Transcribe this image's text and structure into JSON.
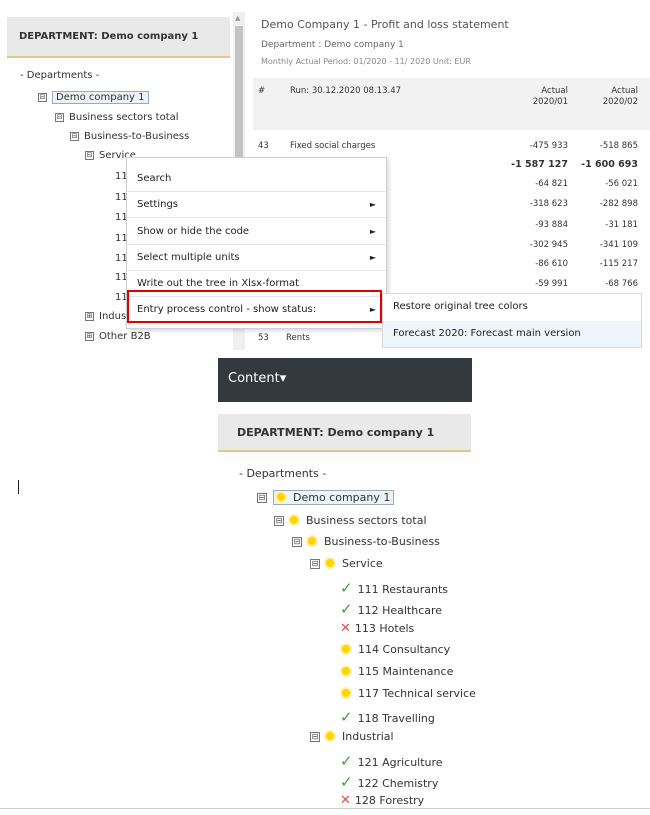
{
  "top": {
    "dept_header": "DEPARTMENT: Demo company 1",
    "tree": {
      "root": "- Departments -",
      "company": "Demo company 1",
      "sectors": "Business sectors total",
      "b2b": "Business-to-Business",
      "service": "Service",
      "partial_codes": [
        "11",
        "11",
        "11",
        "11",
        "11",
        "11",
        "11"
      ],
      "industrial": "Indust",
      "other": "Other B2B",
      "toggle_minus": "⊟",
      "toggle_plus": "⊞"
    },
    "report": {
      "title": "Demo Company 1 - Profit and loss statement",
      "department": "Department : Demo company 1",
      "period": "Monthly Actual Period: 01/2020 - 11/ 2020 Unit: EUR",
      "hash": "#",
      "run": "Run: 30.12.2020 08.13.47",
      "col1_top": "Actual",
      "col1_bottom": "2020/01",
      "col2_top": "Actual",
      "col2_bottom": "2020/02",
      "rows": [
        {
          "num": "43",
          "label": "Fixed social charges",
          "v1": "-475 933",
          "v2": "-518 865"
        },
        {
          "num": "",
          "label": "",
          "v1": "-1 587 127",
          "v2": "-1 600 693"
        },
        {
          "num": "",
          "label": "",
          "v1": "-64 821",
          "v2": "-56 021"
        },
        {
          "num": "",
          "label": "",
          "v1": "-318 623",
          "v2": "-282 898"
        },
        {
          "num": "",
          "label": "",
          "v1": "-93 884",
          "v2": "-31 181"
        },
        {
          "num": "",
          "label": "",
          "v1": "-302 945",
          "v2": "-341 109"
        },
        {
          "num": "",
          "label": "",
          "v1": "-86 610",
          "v2": "-115 217"
        },
        {
          "num": "",
          "label": "",
          "v1": "-59 991",
          "v2": "-68 766"
        },
        {
          "num": "53",
          "label": "Rents",
          "v1": "",
          "v2": ""
        }
      ]
    },
    "context_menu": {
      "items": [
        {
          "label": "Search",
          "has_sub": false
        },
        {
          "label": "Settings",
          "has_sub": true
        },
        {
          "label": "Show or hide the code",
          "has_sub": true
        },
        {
          "label": "Select multiple units",
          "has_sub": true
        },
        {
          "label": "Write out the tree in Xlsx-format",
          "has_sub": false
        },
        {
          "label": "Entry process control - show status:",
          "has_sub": true
        }
      ],
      "caret": "►"
    },
    "submenu": {
      "items": [
        "Restore original tree colors",
        "Forecast 2020: Forecast main version"
      ]
    }
  },
  "bottom": {
    "content_label": "Content",
    "content_caret": "▾",
    "dept_header": "DEPARTMENT: Demo company 1",
    "root": "- Departments -",
    "company": "Demo company 1",
    "sectors": "Business sectors total",
    "b2b": "Business-to-Business",
    "service": "Service",
    "service_items": [
      {
        "code": "111 Restaurants",
        "status": "check"
      },
      {
        "code": "112 Healthcare",
        "status": "check"
      },
      {
        "code": "113 Hotels",
        "status": "cross"
      },
      {
        "code": "114 Consultancy",
        "status": "sun"
      },
      {
        "code": "115 Maintenance",
        "status": "sun"
      },
      {
        "code": "117 Technical service",
        "status": "sun"
      },
      {
        "code": "118 Travelling",
        "status": "check"
      }
    ],
    "industrial": "Industrial",
    "industrial_items": [
      {
        "code": "121 Agriculture",
        "status": "check"
      },
      {
        "code": "122 Chemistry",
        "status": "check"
      },
      {
        "code": "128 Forestry",
        "status": "cross"
      }
    ],
    "icons": {
      "check": "✓",
      "cross": "✕",
      "minus": "⊟"
    }
  },
  "colors": {
    "highlight": "#e00000",
    "header_bar": "#333a3f",
    "check": "#3ca33c",
    "cross": "#d9534f",
    "sun": "#ffd400"
  }
}
